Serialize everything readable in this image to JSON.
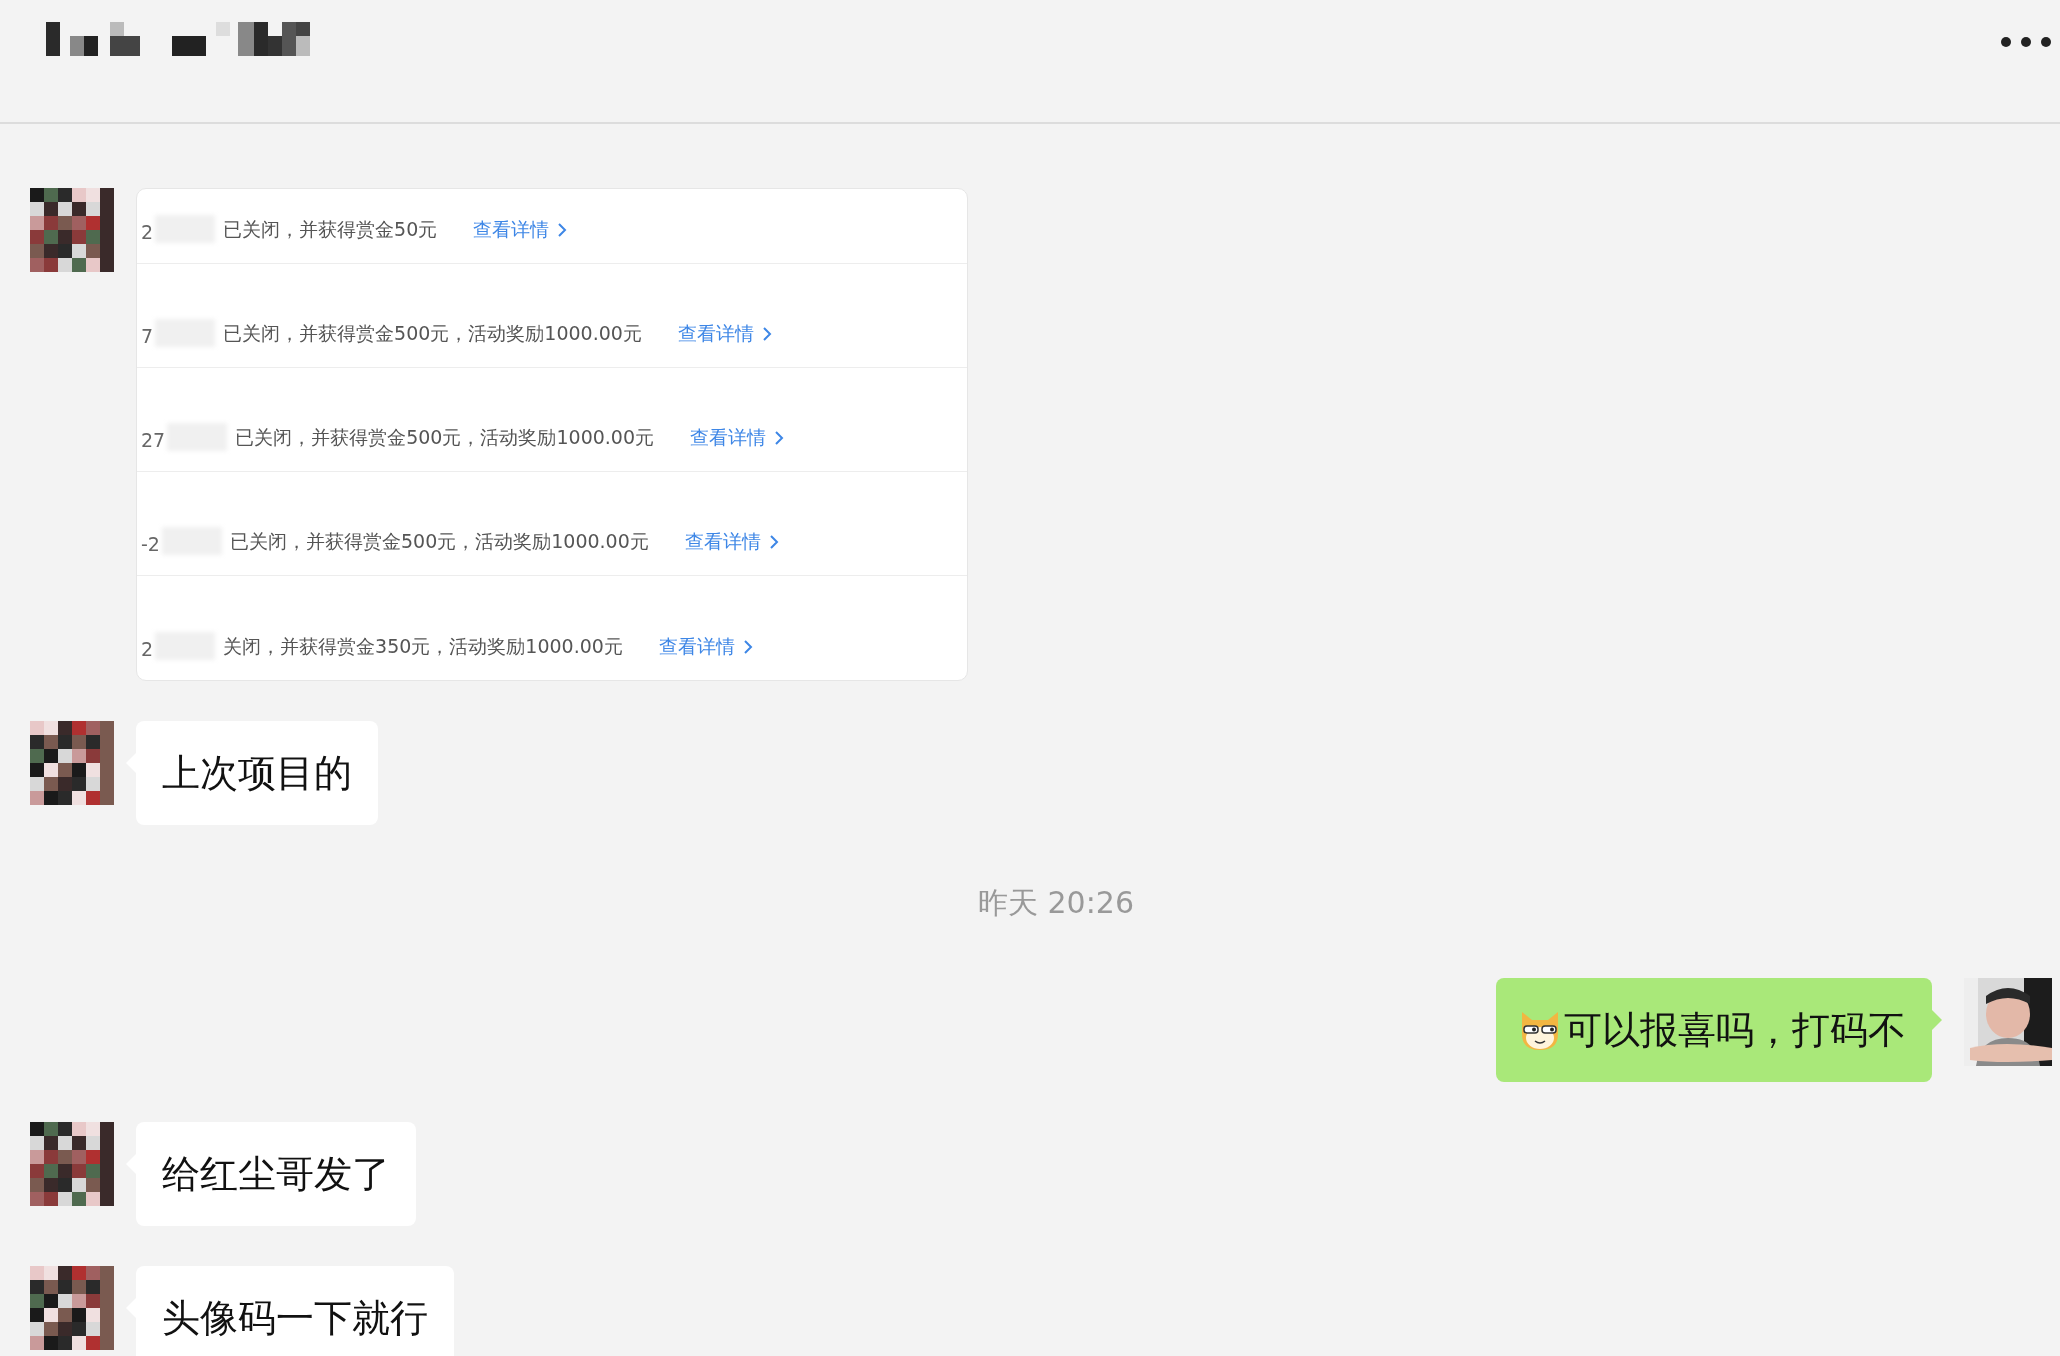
{
  "messages": [
    {
      "kind": "card",
      "outgoing": false,
      "rows": [
        {
          "prefix": "2",
          "text": "已关闭，并获得赏金50元",
          "link": "查看详情"
        },
        {
          "prefix": "7",
          "text": "已关闭，并获得赏金500元，活动奖励1000.00元",
          "link": "查看详情"
        },
        {
          "prefix": "27",
          "text": "已关闭，并获得赏金500元，活动奖励1000.00元",
          "link": "查看详情"
        },
        {
          "prefix": "-2",
          "text": "已关闭，并获得赏金500元，活动奖励1000.00元",
          "link": "查看详情"
        },
        {
          "prefix": "2",
          "text": "关闭，并获得赏金350元，活动奖励1000.00元",
          "link": "查看详情"
        }
      ]
    },
    {
      "kind": "text",
      "outgoing": false,
      "text": "上次项目的"
    },
    {
      "kind": "timestamp",
      "text": "昨天 20:26"
    },
    {
      "kind": "text",
      "outgoing": true,
      "emoji": true,
      "text": "可以报喜吗，打码不"
    },
    {
      "kind": "text",
      "outgoing": false,
      "text": "给红尘哥发了"
    },
    {
      "kind": "text",
      "outgoing": false,
      "text": "头像码一下就行"
    }
  ]
}
